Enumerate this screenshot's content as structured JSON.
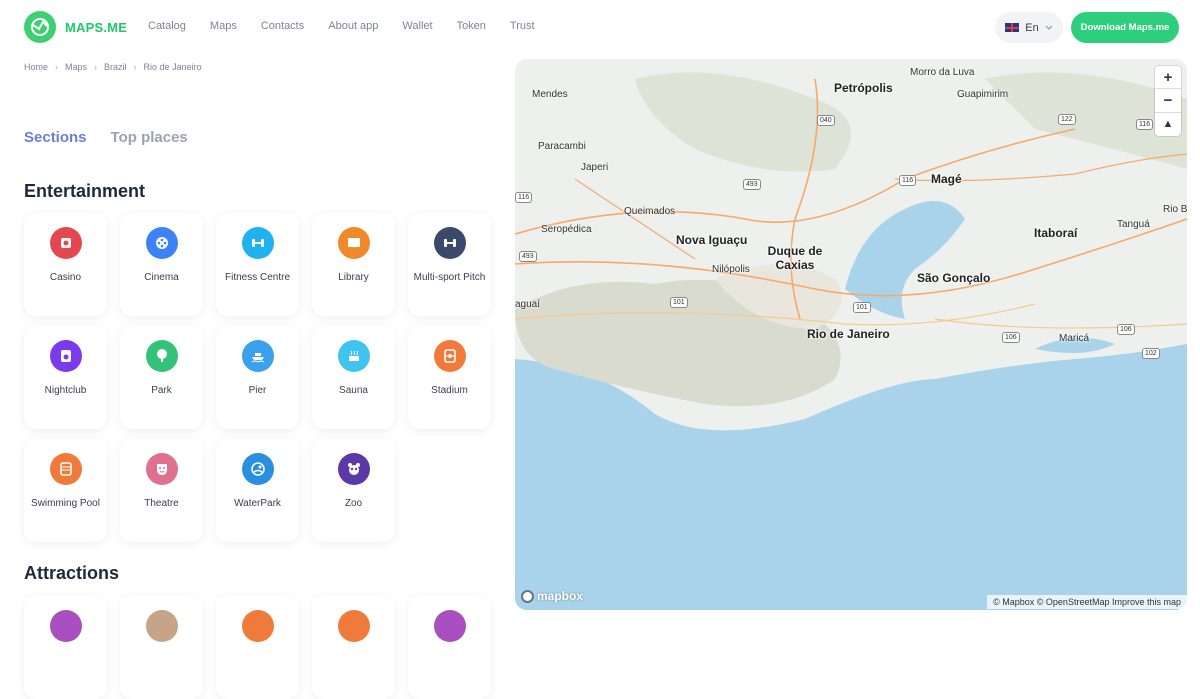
{
  "header": {
    "brand": "MAPS.ME",
    "nav": [
      "Catalog",
      "Maps",
      "Contacts",
      "About app",
      "Wallet",
      "Token",
      "Trust"
    ],
    "language": "En",
    "download_label": "Download Maps.me"
  },
  "breadcrumb": [
    "Home",
    "Maps",
    "Brazil",
    "Rio de Janeiro"
  ],
  "tabs": [
    {
      "label": "Sections",
      "active": true
    },
    {
      "label": "Top places",
      "active": false
    }
  ],
  "entertainment": {
    "title": "Entertainment",
    "items": [
      {
        "label": "Casino",
        "icon": "casino-icon",
        "color": "#e5474f"
      },
      {
        "label": "Cinema",
        "icon": "film-reel-icon",
        "color": "#3b82f6"
      },
      {
        "label": "Fitness Centre",
        "icon": "dumbbell-icon",
        "color": "#1fb2ee"
      },
      {
        "label": "Library",
        "icon": "book-icon",
        "color": "#f0892a"
      },
      {
        "label": "Multi-sport Pitch",
        "icon": "dumbbell-icon",
        "color": "#3b4a6b"
      },
      {
        "label": "Nightclub",
        "icon": "speaker-icon",
        "color": "#7c3aed"
      },
      {
        "label": "Park",
        "icon": "tree-icon",
        "color": "#34c27a"
      },
      {
        "label": "Pier",
        "icon": "boat-icon",
        "color": "#3aa1ee"
      },
      {
        "label": "Sauna",
        "icon": "sauna-icon",
        "color": "#41c3f0"
      },
      {
        "label": "Stadium",
        "icon": "stadium-icon",
        "color": "#f07a3a"
      },
      {
        "label": "Swimming Pool",
        "icon": "pool-icon",
        "color": "#f07a3a"
      },
      {
        "label": "Theatre",
        "icon": "theatre-mask-icon",
        "color": "#e07090"
      },
      {
        "label": "WaterPark",
        "icon": "swimmer-icon",
        "color": "#2a8fe0"
      },
      {
        "label": "Zoo",
        "icon": "panda-icon",
        "color": "#5b3aa8"
      }
    ]
  },
  "attractions": {
    "title": "Attractions",
    "items": [
      {
        "icon": "attraction-icon",
        "color": "#a94fc0"
      },
      {
        "icon": "attraction-icon",
        "color": "#c7a488"
      },
      {
        "icon": "attraction-icon",
        "color": "#f07a3a"
      },
      {
        "icon": "attraction-icon",
        "color": "#f07a3a"
      },
      {
        "icon": "attraction-icon",
        "color": "#a94fc0"
      }
    ]
  },
  "map": {
    "cities": [
      "Nova Iguaçu",
      "Duque de Caxias",
      "Rio de Janeiro",
      "São Gonçalo",
      "Petrópolis",
      "Magé",
      "Itaboraí"
    ],
    "towns": [
      "Mendes",
      "Paracambi",
      "Japeri",
      "Queimados",
      "Seropédica",
      "Nilópolis",
      "Morro da Luva",
      "Guapimirim",
      "Tanguá",
      "Maricá",
      "Rio Bo",
      "aguaí"
    ],
    "shields": [
      "040",
      "493",
      "116",
      "116",
      "493",
      "116",
      "122",
      "101",
      "101",
      "106",
      "106",
      "102",
      "116"
    ],
    "zoom_in": "+",
    "zoom_out": "−",
    "compass": "▲",
    "mapbox_label": "mapbox",
    "attribution": "© Mapbox © OpenStreetMap Improve this map"
  }
}
